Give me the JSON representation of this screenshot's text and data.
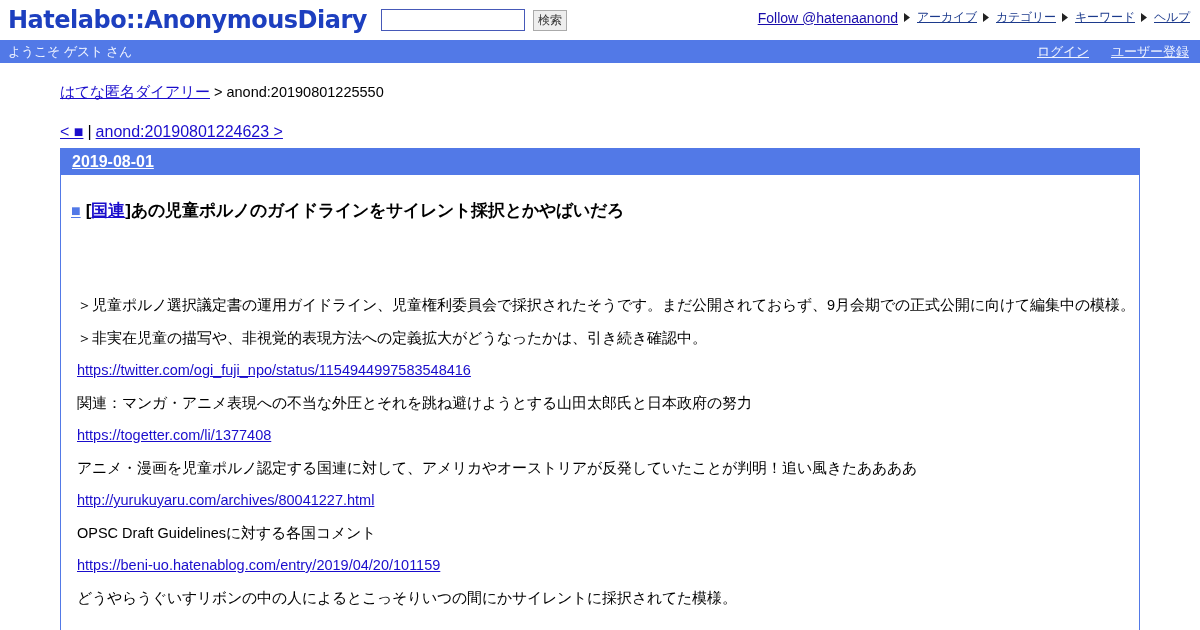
{
  "header": {
    "logo": "Hatelabo::AnonymousDiary",
    "search": {
      "button": "検索"
    },
    "follow": "Follow @hatenaanond",
    "links": [
      "アーカイブ",
      "カテゴリー",
      "キーワード",
      "ヘルプ"
    ]
  },
  "userbar": {
    "welcome": "ようこそ ゲスト さん",
    "links": [
      "ログイン",
      "ユーザー登録"
    ]
  },
  "breadcrumb": {
    "home": "はてな匿名ダイアリー",
    "current": "> anond:20190801225550"
  },
  "pager": {
    "prev": "< ■",
    "separator": "|",
    "next": "anond:20190801224623 >"
  },
  "entry": {
    "date": "2019-08-01",
    "anchor": "■",
    "bracket_open": "[",
    "category": "国連",
    "bracket_close": "]",
    "title": "あの児童ポルノのガイドラインをサイレント採択とかやばいだろ",
    "paragraphs": [
      {
        "kind": "text",
        "text": "＞児童ポルノ選択議定書の運用ガイドライン、児童権利委員会で採択されたそうです。まだ公開されておらず、9月会期での正式公開に向けて編集中の模様。"
      },
      {
        "kind": "text",
        "text": "＞非実在児童の描写や、非視覚的表現方法への定義拡大がどうなったかは、引き続き確認中。"
      },
      {
        "kind": "link",
        "text": "https://twitter.com/ogi_fuji_npo/status/1154944997583548416"
      },
      {
        "kind": "text",
        "text": "関連：マンガ・アニメ表現への不当な外圧とそれを跳ね避けようとする山田太郎氏と日本政府の努力"
      },
      {
        "kind": "link",
        "text": "https://togetter.com/li/1377408"
      },
      {
        "kind": "text",
        "text": "アニメ・漫画を児童ポルノ認定する国連に対して、アメリカやオーストリアが反発していたことが判明！追い風きたああああ"
      },
      {
        "kind": "link",
        "text": "http://yurukuyaru.com/archives/80041227.html"
      },
      {
        "kind": "text",
        "text": "OPSC Draft Guidelinesに対する各国コメント"
      },
      {
        "kind": "link",
        "text": "https://beni-uo.hatenablog.com/entry/2019/04/20/101159"
      },
      {
        "kind": "text",
        "text": "どうやらうぐいすリボンの中の人によるとこっそりいつの間にかサイレントに採択されてた模様。"
      }
    ]
  }
}
